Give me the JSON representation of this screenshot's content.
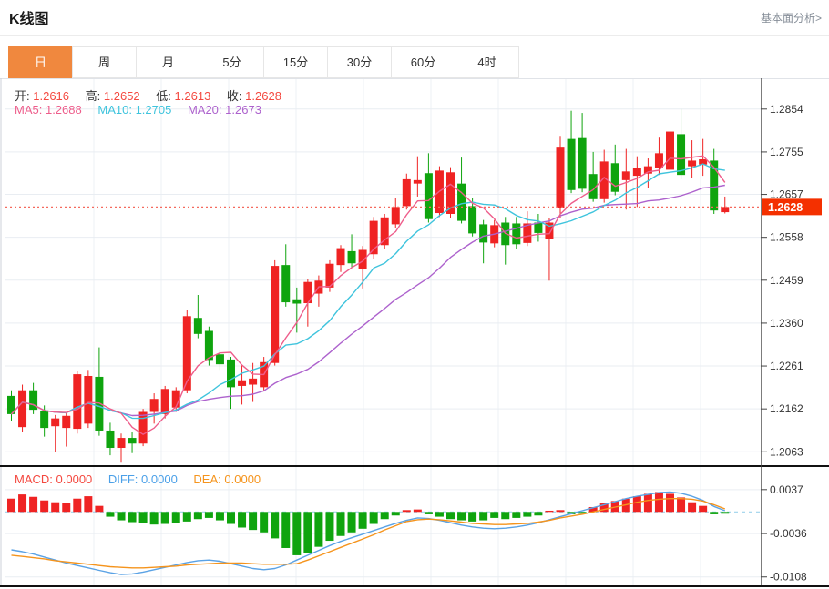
{
  "header": {
    "title": "K线图",
    "link": "基本面分析>"
  },
  "tabs": {
    "active_index": 0,
    "active_color": "#f0883e",
    "items": [
      {
        "label": "日",
        "name": "tab-day"
      },
      {
        "label": "周",
        "name": "tab-week"
      },
      {
        "label": "月",
        "name": "tab-month"
      },
      {
        "label": "5分",
        "name": "tab-5min"
      },
      {
        "label": "15分",
        "name": "tab-15min"
      },
      {
        "label": "30分",
        "name": "tab-30min"
      },
      {
        "label": "60分",
        "name": "tab-60min"
      },
      {
        "label": "4时",
        "name": "tab-4hour"
      }
    ]
  },
  "legend": {
    "ohlc": [
      {
        "label": "开:",
        "value": "1.2616"
      },
      {
        "label": "高:",
        "value": "1.2652"
      },
      {
        "label": "低:",
        "value": "1.2613"
      },
      {
        "label": "收:",
        "value": "1.2628"
      }
    ],
    "ma": [
      {
        "label": "MA5:",
        "value": "1.2688"
      },
      {
        "label": "MA10:",
        "value": "1.2705"
      },
      {
        "label": "MA20:",
        "value": "1.2673"
      }
    ],
    "macd": [
      {
        "label": "MACD:",
        "value": "0.0000"
      },
      {
        "label": "DIFF:",
        "value": "0.0000"
      },
      {
        "label": "DEA:",
        "value": "0.0000"
      }
    ]
  },
  "colors": {
    "up": "#ef2323",
    "down": "#0fa40e",
    "ma5": "#ee5d8b",
    "ma10": "#3fc4dd",
    "ma20": "#ad62cd",
    "diff_line": "#5aa2e5",
    "dea_line": "#f5941d",
    "price_line": "#f56a5e",
    "price_tag_bg": "#f43000",
    "grid": "#e9edf2",
    "vgrid": "#edf1f5",
    "axis": "#444",
    "zero_dash": "#9ed2ec",
    "separator": "#111",
    "tab_active": "#f0883e"
  },
  "chart_data": [
    {
      "type": "candlestick",
      "title": "K线图 (日)",
      "y_axis_labels": [
        "1.2854",
        "1.2755",
        "1.2657",
        "1.2558",
        "1.2459",
        "1.2360",
        "1.2261",
        "1.2162",
        "1.2063"
      ],
      "y_axis_values": [
        1.2854,
        1.2755,
        1.2657,
        1.2558,
        1.2459,
        1.236,
        1.2261,
        1.2162,
        1.2063
      ],
      "ylim": [
        1.203,
        1.2925
      ],
      "current_price": 1.2628,
      "price_tag": "1.2628",
      "ma_periods": [
        5,
        10,
        20
      ],
      "grid": true,
      "candles_ohlc_note": "each candle = [open, high, low, close]; red=up green=down",
      "candles": [
        [
          1.2192,
          1.2205,
          1.2135,
          1.215
        ],
        [
          1.212,
          1.2218,
          1.2108,
          1.2205
        ],
        [
          1.2205,
          1.2222,
          1.215,
          1.216
        ],
        [
          1.2158,
          1.217,
          1.2098,
          1.2118
        ],
        [
          1.2122,
          1.2148,
          1.2062,
          1.214
        ],
        [
          1.2118,
          1.2152,
          1.2075,
          1.2146
        ],
        [
          1.2116,
          1.225,
          1.2105,
          1.2242
        ],
        [
          1.2128,
          1.2252,
          1.2118,
          1.2238
        ],
        [
          1.2236,
          1.2304,
          1.21,
          1.2112
        ],
        [
          1.2112,
          1.213,
          1.2055,
          1.2072
        ],
        [
          1.2072,
          1.2105,
          1.2038,
          1.2095
        ],
        [
          1.2095,
          1.2108,
          1.206,
          1.2082
        ],
        [
          1.2082,
          1.2162,
          1.2076,
          1.2155
        ],
        [
          1.2155,
          1.2198,
          1.2128,
          1.2185
        ],
        [
          1.215,
          1.2215,
          1.214,
          1.2208
        ],
        [
          1.2165,
          1.2212,
          1.2155,
          1.2205
        ],
        [
          1.2205,
          1.239,
          1.2198,
          1.2376
        ],
        [
          1.2372,
          1.2425,
          1.2325,
          1.2335
        ],
        [
          1.2342,
          1.2352,
          1.2262,
          1.2275
        ],
        [
          1.2288,
          1.2298,
          1.2252,
          1.2265
        ],
        [
          1.2276,
          1.2282,
          1.2162,
          1.2212
        ],
        [
          1.2215,
          1.2262,
          1.2172,
          1.2228
        ],
        [
          1.2218,
          1.2268,
          1.2178,
          1.2232
        ],
        [
          1.2212,
          1.2282,
          1.2205,
          1.227
        ],
        [
          1.2268,
          1.2505,
          1.2262,
          1.2492
        ],
        [
          1.2494,
          1.2542,
          1.2398,
          1.2408
        ],
        [
          1.2415,
          1.2442,
          1.2338,
          1.2405
        ],
        [
          1.2406,
          1.2462,
          1.2352,
          1.2455
        ],
        [
          1.2428,
          1.247,
          1.2398,
          1.2458
        ],
        [
          1.2442,
          1.2505,
          1.2432,
          1.2497
        ],
        [
          1.2494,
          1.254,
          1.2478,
          1.2533
        ],
        [
          1.2526,
          1.2565,
          1.2488,
          1.2498
        ],
        [
          1.2484,
          1.2538,
          1.244,
          1.2529
        ],
        [
          1.2519,
          1.2605,
          1.2508,
          1.2596
        ],
        [
          1.254,
          1.2612,
          1.253,
          1.2604
        ],
        [
          1.2588,
          1.2648,
          1.258,
          1.2628
        ],
        [
          1.263,
          1.2705,
          1.2622,
          1.2692
        ],
        [
          1.2682,
          1.2745,
          1.2652,
          1.269
        ],
        [
          1.2706,
          1.2752,
          1.2592,
          1.26
        ],
        [
          1.2614,
          1.2722,
          1.2605,
          1.2712
        ],
        [
          1.2612,
          1.272,
          1.2602,
          1.2708
        ],
        [
          1.2682,
          1.2742,
          1.259,
          1.2596
        ],
        [
          1.263,
          1.2648,
          1.256,
          1.2567
        ],
        [
          1.2588,
          1.2598,
          1.2498,
          1.2546
        ],
        [
          1.2544,
          1.2598,
          1.2535,
          1.2586
        ],
        [
          1.2592,
          1.2605,
          1.2495,
          1.254
        ],
        [
          1.259,
          1.2605,
          1.2532,
          1.2542
        ],
        [
          1.2545,
          1.2618,
          1.2538,
          1.259
        ],
        [
          1.2592,
          1.2612,
          1.2548,
          1.2568
        ],
        [
          1.2555,
          1.2602,
          1.2458,
          1.2592
        ],
        [
          1.2625,
          1.2792,
          1.2602,
          1.2765
        ],
        [
          1.2785,
          1.285,
          1.266,
          1.2667
        ],
        [
          1.2787,
          1.2845,
          1.2662,
          1.267
        ],
        [
          1.2704,
          1.2755,
          1.264,
          1.2646
        ],
        [
          1.2646,
          1.276,
          1.2638,
          1.2733
        ],
        [
          1.2729,
          1.2772,
          1.2655,
          1.2663
        ],
        [
          1.269,
          1.2762,
          1.2622,
          1.271
        ],
        [
          1.27,
          1.2745,
          1.2628,
          1.2717
        ],
        [
          1.2705,
          1.274,
          1.2672,
          1.2722
        ],
        [
          1.2718,
          1.2788,
          1.2702,
          1.2752
        ],
        [
          1.2714,
          1.2812,
          1.2705,
          1.2802
        ],
        [
          1.2796,
          1.2854,
          1.2692,
          1.2702
        ],
        [
          1.2722,
          1.2782,
          1.2695,
          1.2735
        ],
        [
          1.2726,
          1.2785,
          1.27,
          1.2738
        ],
        [
          1.2735,
          1.2762,
          1.2612,
          1.262
        ],
        [
          1.2616,
          1.2652,
          1.2613,
          1.2628
        ]
      ]
    },
    {
      "type": "bar",
      "title": "MACD(12,26,9)",
      "y_axis_labels": [
        "0.0037",
        "-0.0036",
        "-0.0108"
      ],
      "y_axis_values": [
        0.0037,
        -0.0036,
        -0.0108
      ],
      "ylim": [
        -0.0122,
        0.0073
      ],
      "zero_line": 0,
      "hist": [
        0.0022,
        0.0029,
        0.0025,
        0.0019,
        0.0016,
        0.0015,
        0.0022,
        0.0026,
        0.001,
        -0.0008,
        -0.0014,
        -0.0017,
        -0.0019,
        -0.0021,
        -0.002,
        -0.0018,
        -0.0016,
        -0.0012,
        -0.001,
        -0.0014,
        -0.002,
        -0.0026,
        -0.003,
        -0.0034,
        -0.0044,
        -0.006,
        -0.0072,
        -0.0068,
        -0.0058,
        -0.0048,
        -0.004,
        -0.0034,
        -0.0028,
        -0.002,
        -0.0012,
        -0.0006,
        0.0003,
        0.0004,
        -0.0004,
        -0.0008,
        -0.0012,
        -0.0014,
        -0.0016,
        -0.0014,
        -0.001,
        -0.0012,
        -0.001,
        -0.0008,
        -0.0006,
        0.0002,
        0.0003,
        -0.0004,
        -0.0003,
        0.0008,
        0.0014,
        0.0018,
        0.0022,
        0.0026,
        0.003,
        0.0033,
        0.003,
        0.0024,
        0.0016,
        0.001,
        -0.0004,
        -0.0003
      ],
      "series": [
        {
          "name": "DIFF",
          "values": [
            -0.0063,
            -0.0066,
            -0.007,
            -0.0075,
            -0.008,
            -0.0085,
            -0.0089,
            -0.0093,
            -0.0097,
            -0.0101,
            -0.0104,
            -0.0103,
            -0.01,
            -0.0096,
            -0.0092,
            -0.0088,
            -0.0084,
            -0.0081,
            -0.008,
            -0.0082,
            -0.0086,
            -0.009,
            -0.0094,
            -0.0096,
            -0.0094,
            -0.0088,
            -0.008,
            -0.0072,
            -0.0064,
            -0.0056,
            -0.0049,
            -0.0043,
            -0.0037,
            -0.0031,
            -0.0025,
            -0.0019,
            -0.0014,
            -0.001,
            -0.0011,
            -0.0014,
            -0.0018,
            -0.0022,
            -0.0025,
            -0.0027,
            -0.0028,
            -0.0027,
            -0.0025,
            -0.0022,
            -0.0018,
            -0.0013,
            -0.0008,
            -0.0003,
            0.0002,
            0.0007,
            0.0012,
            0.0017,
            0.0022,
            0.0026,
            0.0029,
            0.0032,
            0.0033,
            0.0031,
            0.0026,
            0.0019,
            0.0009,
            0.0002
          ]
        },
        {
          "name": "DEA",
          "values": [
            -0.0072,
            -0.0074,
            -0.0076,
            -0.0078,
            -0.0081,
            -0.0083,
            -0.0085,
            -0.0087,
            -0.0089,
            -0.0091,
            -0.0092,
            -0.0093,
            -0.0093,
            -0.0092,
            -0.0091,
            -0.009,
            -0.0088,
            -0.0087,
            -0.0086,
            -0.0085,
            -0.0085,
            -0.0085,
            -0.0086,
            -0.0087,
            -0.0087,
            -0.0087,
            -0.0086,
            -0.008,
            -0.0073,
            -0.0066,
            -0.0059,
            -0.0052,
            -0.0045,
            -0.0038,
            -0.003,
            -0.0023,
            -0.0016,
            -0.0013,
            -0.0012,
            -0.0013,
            -0.0015,
            -0.0017,
            -0.0019,
            -0.002,
            -0.0021,
            -0.0021,
            -0.002,
            -0.0019,
            -0.0017,
            -0.0014,
            -0.001,
            -0.0007,
            -0.0004,
            0.0,
            0.0004,
            0.0008,
            0.0012,
            0.0016,
            0.0019,
            0.0021,
            0.0022,
            0.0022,
            0.0021,
            0.0018,
            0.0012,
            0.0005
          ]
        }
      ]
    }
  ]
}
